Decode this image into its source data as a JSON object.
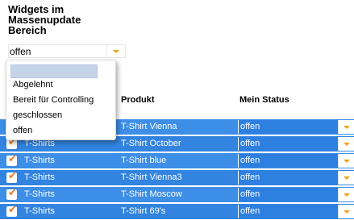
{
  "panel": {
    "heading": "Widgets im Massenupdate Bereich",
    "filter_value": "offen",
    "dropdown_options": [
      "Abgelehnt",
      "Bereit für Controlling",
      "geschlossen",
      "offen"
    ]
  },
  "table": {
    "headers": {
      "product": "Produkt",
      "status": "Mein Status"
    },
    "rows": [
      {
        "category": "",
        "product": "T-Shirt Vienna",
        "status": "offen"
      },
      {
        "category": "T-Shirts",
        "product": "T-Shirt October",
        "status": "offen"
      },
      {
        "category": "T-Shirts",
        "product": "T-Shirt blue",
        "status": "offen"
      },
      {
        "category": "T-Shirts",
        "product": "T-Shirt Vienna3",
        "status": "offen"
      },
      {
        "category": "T-Shirts",
        "product": "T-Shirt Moscow",
        "status": "offen"
      },
      {
        "category": "T-Shirts",
        "product": "T-Shirt 69's",
        "status": "offen"
      }
    ]
  },
  "colors": {
    "row_bg": "#3d8ee6",
    "accent": "#f0a020",
    "check": "#e87d2a"
  }
}
